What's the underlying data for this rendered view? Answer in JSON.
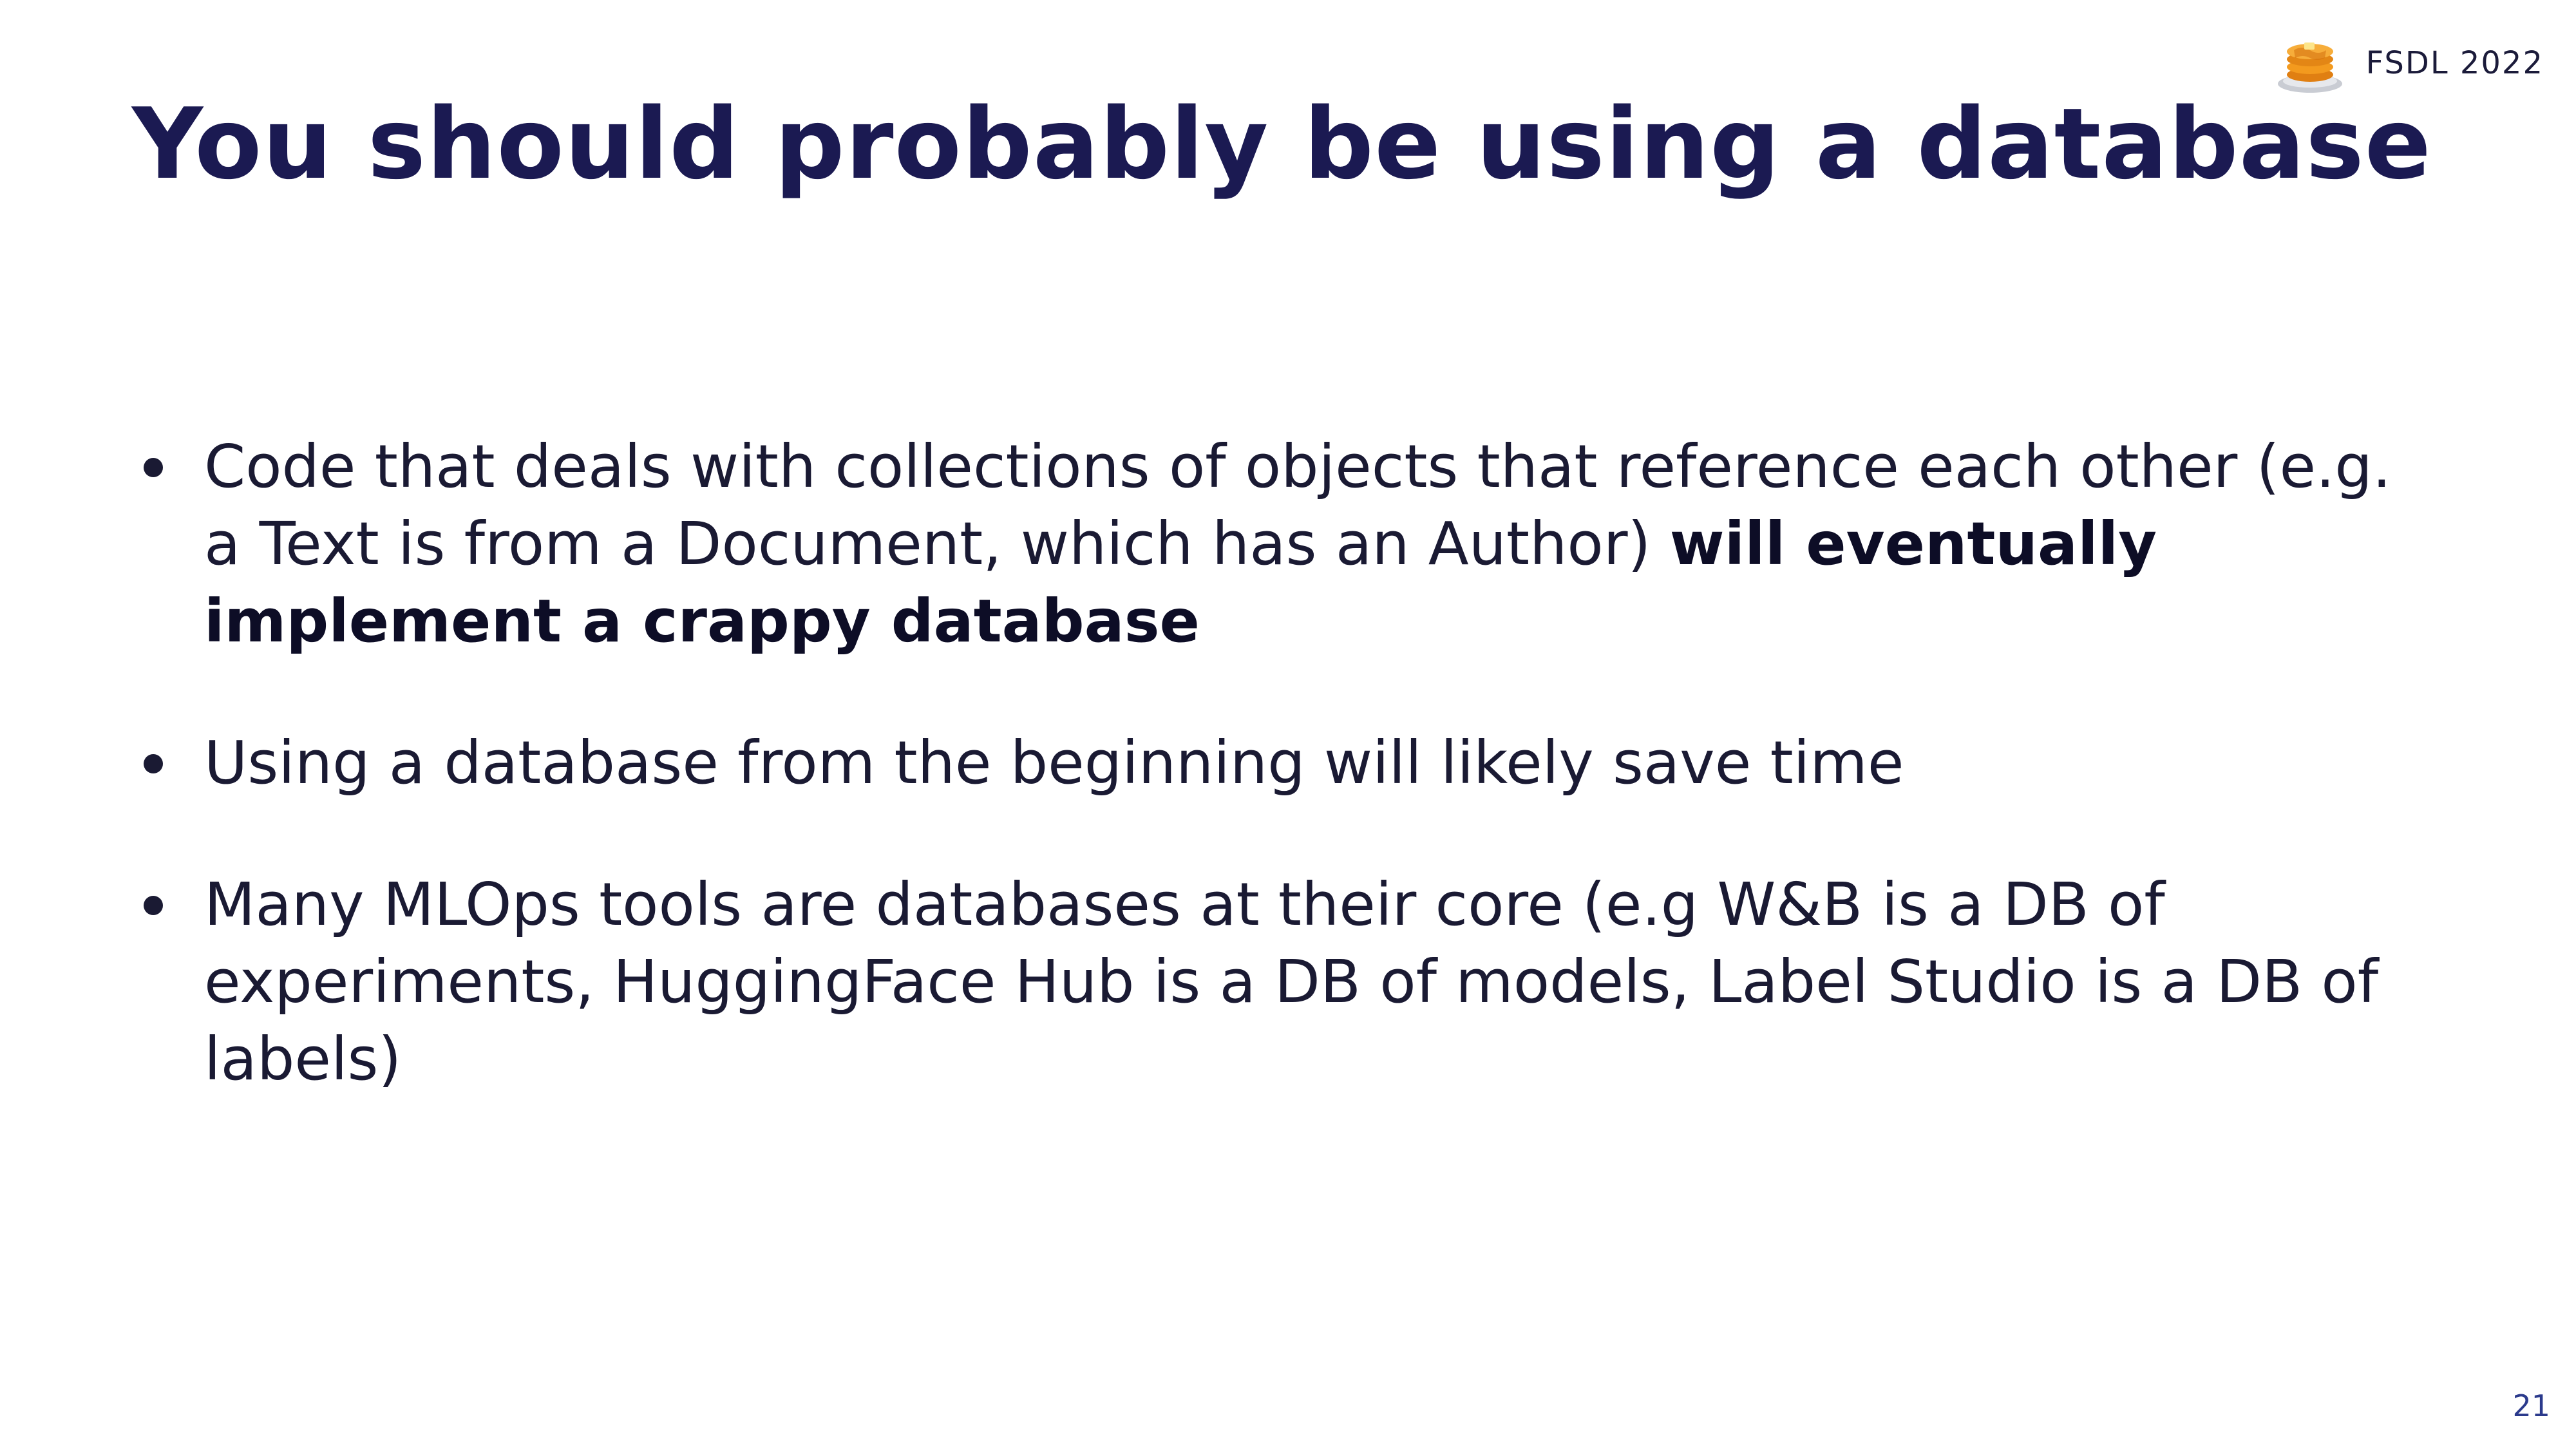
{
  "header": {
    "brand_text": "FSDL 2022",
    "logo_icon": "pancake-stack-icon"
  },
  "slide": {
    "title": "You should probably be using a database",
    "bullets": [
      {
        "text": "Code that deals with collections of objects that reference each other (e.g. a Text is from a Document, which has an Author) ",
        "bold": "will eventually implement a crappy database"
      },
      {
        "text": "Using a database from the beginning will likely save time"
      },
      {
        "text": "Many MLOps tools are databases at their core (e.g W&B is a DB of experiments, HuggingFace Hub is a DB of models, Label Studio is a DB of labels)"
      }
    ],
    "page_number": "21"
  },
  "colors": {
    "title": "#1b1a52",
    "body_text": "#1a1a33",
    "page_number": "#2b3a8c",
    "logo_orange": "#f39a1e",
    "logo_plate": "#c9ccd3"
  }
}
